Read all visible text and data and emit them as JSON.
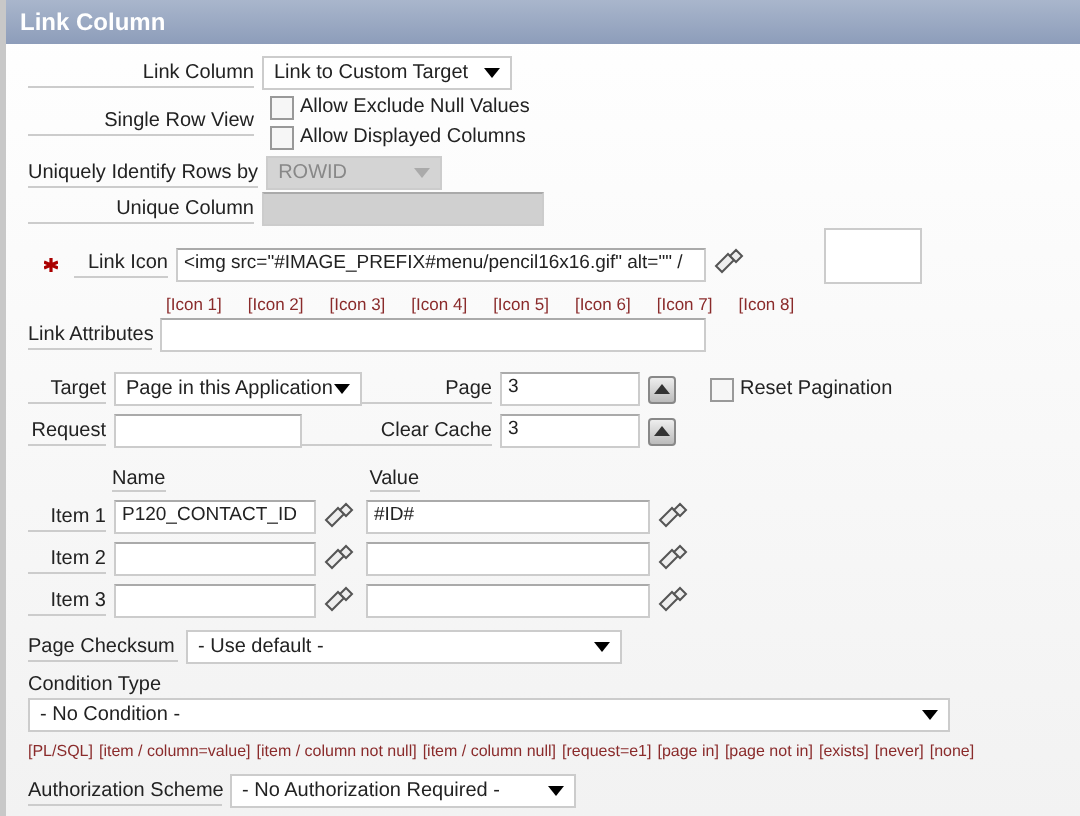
{
  "panel": {
    "title": "Link Column"
  },
  "link_column": {
    "label": "Link Column",
    "value": "Link to Custom Target"
  },
  "single_row_view": {
    "label": "Single Row View",
    "options": [
      {
        "label": "Allow Exclude Null Values",
        "checked": false
      },
      {
        "label": "Allow Displayed Columns",
        "checked": false
      }
    ]
  },
  "unique_rows": {
    "label": "Uniquely Identify Rows by",
    "value": "ROWID",
    "disabled": true
  },
  "unique_column": {
    "label": "Unique Column",
    "disabled": true
  },
  "link_icon": {
    "label": "Link Icon",
    "required": true,
    "value": "<img src=\"#IMAGE_PREFIX#menu/pencil16x16.gif\" alt=\"\" /"
  },
  "icon_links": [
    "[Icon 1]",
    "[Icon 2]",
    "[Icon 3]",
    "[Icon 4]",
    "[Icon 5]",
    "[Icon 6]",
    "[Icon 7]",
    "[Icon 8]"
  ],
  "link_attributes": {
    "label": "Link Attributes"
  },
  "target": {
    "label": "Target",
    "value": "Page in this Application"
  },
  "page": {
    "label": "Page",
    "value": "3"
  },
  "reset_pagination": {
    "label": "Reset Pagination",
    "checked": false
  },
  "request": {
    "label": "Request"
  },
  "clear_cache": {
    "label": "Clear Cache",
    "value": "3"
  },
  "items": {
    "name_header": "Name",
    "value_header": "Value",
    "rows": [
      {
        "label": "Item 1",
        "name": "P120_CONTACT_ID",
        "value": "#ID#"
      },
      {
        "label": "Item 2"
      },
      {
        "label": "Item 3"
      }
    ]
  },
  "page_checksum": {
    "label": "Page Checksum",
    "value": "- Use default -"
  },
  "condition_type": {
    "label": "Condition Type",
    "value": "- No Condition -",
    "shortcuts": [
      "[PL/SQL]",
      "[item / column=value]",
      "[item / column not null]",
      "[item / column null]",
      "[request=e1]",
      "[page in]",
      "[page not in]",
      "[exists]",
      "[never]",
      "[none]"
    ]
  },
  "authorization": {
    "label": "Authorization Scheme",
    "value": "- No Authorization Required -"
  }
}
